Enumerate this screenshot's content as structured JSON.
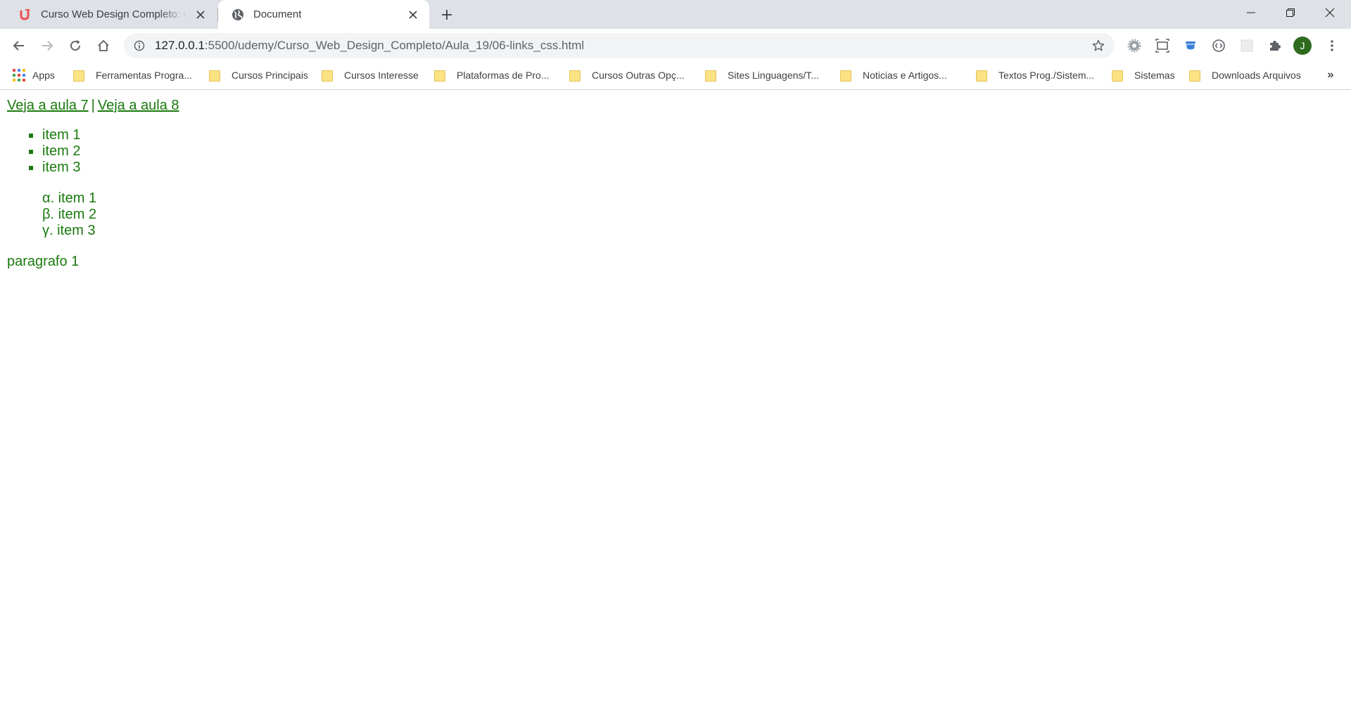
{
  "tabs": [
    {
      "title": "Curso Web Design Completo: HTML",
      "favicon": "udemy-icon",
      "active": false
    },
    {
      "title": "Document",
      "favicon": "globe-icon",
      "active": true
    }
  ],
  "toolbar": {
    "url_host": "127.0.0.1",
    "url_path": ":5500/udemy/Curso_Web_Design_Completo/Aula_19/06-links_css.html",
    "avatar_initial": "J"
  },
  "bookmarks": {
    "apps_label": "Apps",
    "items": [
      "Ferramentas Progra...",
      "Cursos Principais",
      "Cursos Interesse",
      "Plataformas de Pro...",
      "Cursos Outras Opç...",
      "Sites Linguagens/T...",
      "Noticias e Artigos...",
      "Textos Prog./Sistem...",
      "Sistemas",
      "Downloads Arquivos"
    ],
    "more": "»"
  },
  "page": {
    "links": [
      "Veja a aula 7",
      "Veja a aula 8"
    ],
    "link_separator": "|",
    "ul_items": [
      "item 1",
      "item 2",
      "item 3"
    ],
    "ol_items": [
      "α. item 1",
      "β. item 2",
      "γ. item 3"
    ],
    "paragraph": "paragrafo 1"
  },
  "colors": {
    "content_text": "#1a7a0e",
    "tabstrip_bg": "#dee1e6",
    "omnibox_bg": "#f1f3f4"
  }
}
